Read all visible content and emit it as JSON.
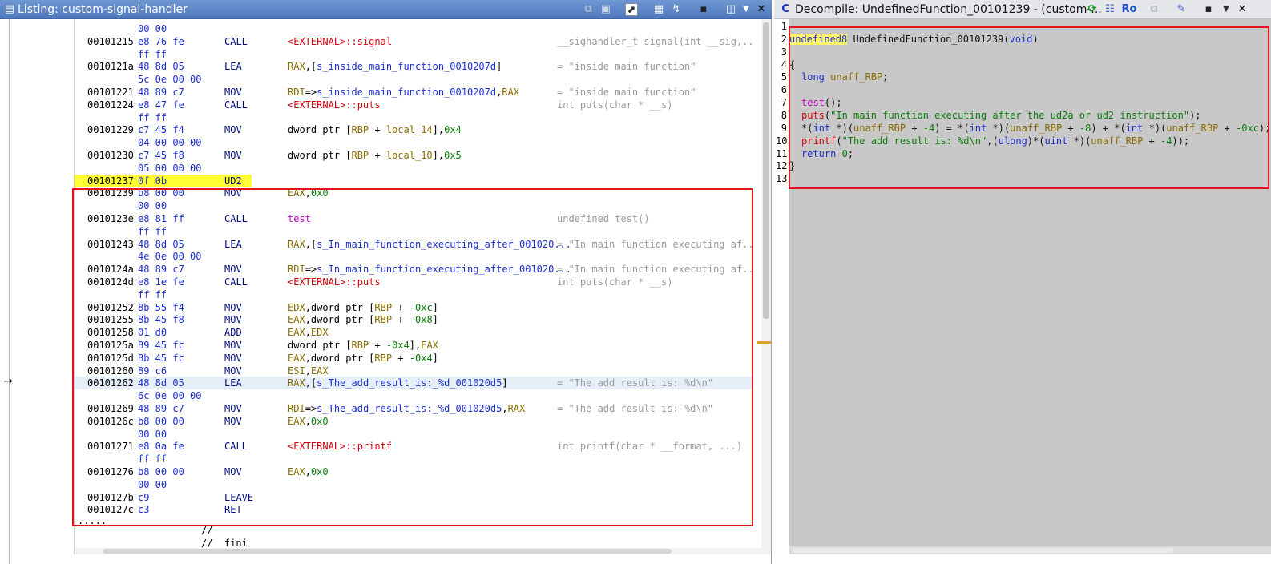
{
  "listing": {
    "title": "Listing:  custom-signal-handler",
    "rows": [
      {
        "addr": "",
        "bytes": "00 00",
        "mn": "",
        "ops": [],
        "cmt": ""
      },
      {
        "addr": "00101215",
        "bytes": "e8 76 fe",
        "mn": "CALL",
        "ops": [
          {
            "t": "<EXTERNAL>::signal",
            "c": "ext"
          }
        ],
        "cmt": "__sighandler_t signal(int __sig,..."
      },
      {
        "addr": "",
        "bytes": "ff ff",
        "mn": "",
        "ops": [],
        "cmt": ""
      },
      {
        "addr": "0010121a",
        "bytes": "48 8d 05",
        "mn": "LEA",
        "ops": [
          {
            "t": "RAX",
            "c": "reg"
          },
          {
            "t": ",[",
            "c": "blk"
          },
          {
            "t": "s_inside_main_function_0010207d",
            "c": "lbl"
          },
          {
            "t": "]",
            "c": "blk"
          }
        ],
        "cmt": "= \"inside main function\""
      },
      {
        "addr": "",
        "bytes": "5c 0e 00 00",
        "mn": "",
        "ops": [],
        "cmt": ""
      },
      {
        "addr": "00101221",
        "bytes": "48 89 c7",
        "mn": "MOV",
        "ops": [
          {
            "t": "RDI",
            "c": "reg"
          },
          {
            "t": "=>",
            "c": "blk"
          },
          {
            "t": "s_inside_main_function_0010207d",
            "c": "lbl"
          },
          {
            "t": ",",
            "c": "blk"
          },
          {
            "t": "RAX",
            "c": "reg"
          }
        ],
        "cmt": "= \"inside main function\""
      },
      {
        "addr": "00101224",
        "bytes": "e8 47 fe",
        "mn": "CALL",
        "ops": [
          {
            "t": "<EXTERNAL>::puts",
            "c": "ext"
          }
        ],
        "cmt": "int puts(char * __s)"
      },
      {
        "addr": "",
        "bytes": "ff ff",
        "mn": "",
        "ops": [],
        "cmt": ""
      },
      {
        "addr": "00101229",
        "bytes": "c7 45 f4",
        "mn": "MOV",
        "ops": [
          {
            "t": "dword ptr [",
            "c": "blk"
          },
          {
            "t": "RBP",
            "c": "reg"
          },
          {
            "t": " + ",
            "c": "blk"
          },
          {
            "t": "local_14",
            "c": "reg"
          },
          {
            "t": "],",
            "c": "blk"
          },
          {
            "t": "0x4",
            "c": "imm"
          }
        ],
        "cmt": ""
      },
      {
        "addr": "",
        "bytes": "04 00 00 00",
        "mn": "",
        "ops": [],
        "cmt": ""
      },
      {
        "addr": "00101230",
        "bytes": "c7 45 f8",
        "mn": "MOV",
        "ops": [
          {
            "t": "dword ptr [",
            "c": "blk"
          },
          {
            "t": "RBP",
            "c": "reg"
          },
          {
            "t": " + ",
            "c": "blk"
          },
          {
            "t": "local_10",
            "c": "reg"
          },
          {
            "t": "],",
            "c": "blk"
          },
          {
            "t": "0x5",
            "c": "imm"
          }
        ],
        "cmt": ""
      },
      {
        "addr": "",
        "bytes": "05 00 00 00",
        "mn": "",
        "ops": [],
        "cmt": ""
      },
      {
        "addr": "00101237",
        "bytes": "0f 0b",
        "mn": "UD2",
        "ops": [],
        "cmt": "",
        "hl": true
      },
      {
        "addr": "00101239",
        "bytes": "b8 00 00",
        "mn": "MOV",
        "ops": [
          {
            "t": "EAX",
            "c": "reg"
          },
          {
            "t": ",",
            "c": "blk"
          },
          {
            "t": "0x0",
            "c": "imm"
          }
        ],
        "cmt": ""
      },
      {
        "addr": "",
        "bytes": "00 00",
        "mn": "",
        "ops": [],
        "cmt": ""
      },
      {
        "addr": "0010123e",
        "bytes": "e8 81 ff",
        "mn": "CALL",
        "ops": [
          {
            "t": "test",
            "c": "fn"
          }
        ],
        "cmt": "undefined test()"
      },
      {
        "addr": "",
        "bytes": "ff ff",
        "mn": "",
        "ops": [],
        "cmt": ""
      },
      {
        "addr": "00101243",
        "bytes": "48 8d 05",
        "mn": "LEA",
        "ops": [
          {
            "t": "RAX",
            "c": "reg"
          },
          {
            "t": ",[",
            "c": "blk"
          },
          {
            "t": "s_In_main_function_executing_after_001020...",
            "c": "lbl"
          }
        ],
        "cmt": "= \"In main function executing af..."
      },
      {
        "addr": "",
        "bytes": "4e 0e 00 00",
        "mn": "",
        "ops": [],
        "cmt": ""
      },
      {
        "addr": "0010124a",
        "bytes": "48 89 c7",
        "mn": "MOV",
        "ops": [
          {
            "t": "RDI",
            "c": "reg"
          },
          {
            "t": "=>",
            "c": "blk"
          },
          {
            "t": "s_In_main_function_executing_after_001020...",
            "c": "lbl"
          }
        ],
        "cmt": "= \"In main function executing af..."
      },
      {
        "addr": "0010124d",
        "bytes": "e8 1e fe",
        "mn": "CALL",
        "ops": [
          {
            "t": "<EXTERNAL>::puts",
            "c": "ext"
          }
        ],
        "cmt": "int puts(char * __s)"
      },
      {
        "addr": "",
        "bytes": "ff ff",
        "mn": "",
        "ops": [],
        "cmt": ""
      },
      {
        "addr": "00101252",
        "bytes": "8b 55 f4",
        "mn": "MOV",
        "ops": [
          {
            "t": "EDX",
            "c": "reg"
          },
          {
            "t": ",dword ptr [",
            "c": "blk"
          },
          {
            "t": "RBP",
            "c": "reg"
          },
          {
            "t": " + ",
            "c": "blk"
          },
          {
            "t": "-0xc",
            "c": "imm"
          },
          {
            "t": "]",
            "c": "blk"
          }
        ],
        "cmt": ""
      },
      {
        "addr": "00101255",
        "bytes": "8b 45 f8",
        "mn": "MOV",
        "ops": [
          {
            "t": "EAX",
            "c": "reg"
          },
          {
            "t": ",dword ptr [",
            "c": "blk"
          },
          {
            "t": "RBP",
            "c": "reg"
          },
          {
            "t": " + ",
            "c": "blk"
          },
          {
            "t": "-0x8",
            "c": "imm"
          },
          {
            "t": "]",
            "c": "blk"
          }
        ],
        "cmt": ""
      },
      {
        "addr": "00101258",
        "bytes": "01 d0",
        "mn": "ADD",
        "ops": [
          {
            "t": "EAX",
            "c": "reg"
          },
          {
            "t": ",",
            "c": "blk"
          },
          {
            "t": "EDX",
            "c": "reg"
          }
        ],
        "cmt": ""
      },
      {
        "addr": "0010125a",
        "bytes": "89 45 fc",
        "mn": "MOV",
        "ops": [
          {
            "t": "dword ptr [",
            "c": "blk"
          },
          {
            "t": "RBP",
            "c": "reg"
          },
          {
            "t": " + ",
            "c": "blk"
          },
          {
            "t": "-0x4",
            "c": "imm"
          },
          {
            "t": "],",
            "c": "blk"
          },
          {
            "t": "EAX",
            "c": "reg"
          }
        ],
        "cmt": ""
      },
      {
        "addr": "0010125d",
        "bytes": "8b 45 fc",
        "mn": "MOV",
        "ops": [
          {
            "t": "EAX",
            "c": "reg"
          },
          {
            "t": ",dword ptr [",
            "c": "blk"
          },
          {
            "t": "RBP",
            "c": "reg"
          },
          {
            "t": " + ",
            "c": "blk"
          },
          {
            "t": "-0x4",
            "c": "imm"
          },
          {
            "t": "]",
            "c": "blk"
          }
        ],
        "cmt": ""
      },
      {
        "addr": "00101260",
        "bytes": "89 c6",
        "mn": "MOV",
        "ops": [
          {
            "t": "ESI",
            "c": "reg"
          },
          {
            "t": ",",
            "c": "blk"
          },
          {
            "t": "EAX",
            "c": "reg"
          }
        ],
        "cmt": ""
      },
      {
        "addr": "00101262",
        "bytes": "48 8d 05",
        "mn": "LEA",
        "ops": [
          {
            "t": "RAX",
            "c": "reg"
          },
          {
            "t": ",[",
            "c": "blk"
          },
          {
            "t": "s_The_add_result_is:_%d_001020d5",
            "c": "lbl"
          },
          {
            "t": "]",
            "c": "blk"
          }
        ],
        "cmt": "= \"The add result is: %d\\n\"",
        "cur": true
      },
      {
        "addr": "",
        "bytes": "6c 0e 00 00",
        "mn": "",
        "ops": [],
        "cmt": ""
      },
      {
        "addr": "00101269",
        "bytes": "48 89 c7",
        "mn": "MOV",
        "ops": [
          {
            "t": "RDI",
            "c": "reg"
          },
          {
            "t": "=>",
            "c": "blk"
          },
          {
            "t": "s_The_add_result_is:_%d_001020d5",
            "c": "lbl"
          },
          {
            "t": ",",
            "c": "blk"
          },
          {
            "t": "RAX",
            "c": "reg"
          }
        ],
        "cmt": "= \"The add result is: %d\\n\""
      },
      {
        "addr": "0010126c",
        "bytes": "b8 00 00",
        "mn": "MOV",
        "ops": [
          {
            "t": "EAX",
            "c": "reg"
          },
          {
            "t": ",",
            "c": "blk"
          },
          {
            "t": "0x0",
            "c": "imm"
          }
        ],
        "cmt": ""
      },
      {
        "addr": "",
        "bytes": "00 00",
        "mn": "",
        "ops": [],
        "cmt": ""
      },
      {
        "addr": "00101271",
        "bytes": "e8 0a fe",
        "mn": "CALL",
        "ops": [
          {
            "t": "<EXTERNAL>::printf",
            "c": "ext"
          }
        ],
        "cmt": "int printf(char * __format, ...)"
      },
      {
        "addr": "",
        "bytes": "ff ff",
        "mn": "",
        "ops": [],
        "cmt": ""
      },
      {
        "addr": "00101276",
        "bytes": "b8 00 00",
        "mn": "MOV",
        "ops": [
          {
            "t": "EAX",
            "c": "reg"
          },
          {
            "t": ",",
            "c": "blk"
          },
          {
            "t": "0x0",
            "c": "imm"
          }
        ],
        "cmt": ""
      },
      {
        "addr": "",
        "bytes": "00 00",
        "mn": "",
        "ops": [],
        "cmt": ""
      },
      {
        "addr": "0010127b",
        "bytes": "c9",
        "mn": "LEAVE",
        "ops": [],
        "cmt": ""
      },
      {
        "addr": "0010127c",
        "bytes": "c3",
        "mn": "RET",
        "ops": [],
        "cmt": ""
      }
    ],
    "trailer": [
      ".....",
      "//",
      "//  fini"
    ]
  },
  "decompile": {
    "title": "Decompile: UndefinedFunction_00101239 -  (custom-...",
    "ro_label": "Ro",
    "lines": [
      {
        "n": "1",
        "toks": []
      },
      {
        "n": "2",
        "toks": [
          {
            "t": "undefined8",
            "c": "ty hlty"
          },
          {
            "t": " UndefinedFunction_00101239(",
            "c": "ufn"
          },
          {
            "t": "void",
            "c": "kw"
          },
          {
            "t": ")",
            "c": "ufn"
          }
        ],
        "indent": 0
      },
      {
        "n": "3",
        "toks": []
      },
      {
        "n": "4",
        "toks": [
          {
            "t": "{",
            "c": "ufn"
          }
        ],
        "indent": 0
      },
      {
        "n": "5",
        "toks": [
          {
            "t": "long",
            "c": "kw"
          },
          {
            "t": " ",
            "c": "ufn"
          },
          {
            "t": "unaff_RBP",
            "c": "var"
          },
          {
            "t": ";",
            "c": "ufn"
          }
        ],
        "indent": 1
      },
      {
        "n": "6",
        "toks": []
      },
      {
        "n": "7",
        "toks": [
          {
            "t": "test",
            "c": "dfn"
          },
          {
            "t": "();",
            "c": "ufn"
          }
        ],
        "indent": 1
      },
      {
        "n": "8",
        "toks": [
          {
            "t": "puts",
            "c": "ext"
          },
          {
            "t": "(",
            "c": "ufn"
          },
          {
            "t": "\"In main function executing after the ud2a or ud2 instruction\"",
            "c": "str"
          },
          {
            "t": ");",
            "c": "ufn"
          }
        ],
        "indent": 1
      },
      {
        "n": "9",
        "toks": [
          {
            "t": "*(",
            "c": "ufn"
          },
          {
            "t": "int",
            "c": "kw"
          },
          {
            "t": " *)(",
            "c": "ufn"
          },
          {
            "t": "unaff_RBP",
            "c": "var"
          },
          {
            "t": " + ",
            "c": "ufn"
          },
          {
            "t": "-4",
            "c": "num"
          },
          {
            "t": ") = *(",
            "c": "ufn"
          },
          {
            "t": "int",
            "c": "kw"
          },
          {
            "t": " *)(",
            "c": "ufn"
          },
          {
            "t": "unaff_RBP",
            "c": "var"
          },
          {
            "t": " + ",
            "c": "ufn"
          },
          {
            "t": "-8",
            "c": "num"
          },
          {
            "t": ") + *(",
            "c": "ufn"
          },
          {
            "t": "int",
            "c": "kw"
          },
          {
            "t": " *)(",
            "c": "ufn"
          },
          {
            "t": "unaff_RBP",
            "c": "var"
          },
          {
            "t": " + ",
            "c": "ufn"
          },
          {
            "t": "-0xc",
            "c": "num"
          },
          {
            "t": ");",
            "c": "ufn"
          }
        ],
        "indent": 1
      },
      {
        "n": "10",
        "toks": [
          {
            "t": "printf",
            "c": "ext"
          },
          {
            "t": "(",
            "c": "ufn"
          },
          {
            "t": "\"The add result is: %d\\n\"",
            "c": "str"
          },
          {
            "t": ",(",
            "c": "ufn"
          },
          {
            "t": "ulong",
            "c": "kw"
          },
          {
            "t": ")*(",
            "c": "ufn"
          },
          {
            "t": "uint",
            "c": "kw"
          },
          {
            "t": " *)(",
            "c": "ufn"
          },
          {
            "t": "unaff_RBP",
            "c": "var"
          },
          {
            "t": " + ",
            "c": "ufn"
          },
          {
            "t": "-4",
            "c": "num"
          },
          {
            "t": "));",
            "c": "ufn"
          }
        ],
        "indent": 1
      },
      {
        "n": "11",
        "toks": [
          {
            "t": "return",
            "c": "kw"
          },
          {
            "t": " ",
            "c": "ufn"
          },
          {
            "t": "0",
            "c": "num"
          },
          {
            "t": ";",
            "c": "ufn"
          }
        ],
        "indent": 1
      },
      {
        "n": "12",
        "toks": [
          {
            "t": "}",
            "c": "ufn"
          }
        ],
        "indent": 0
      },
      {
        "n": "13",
        "toks": []
      }
    ]
  },
  "colors": {
    "highlight_line": "#ffff33",
    "annotation_box": "#e0141e",
    "decompile_bg": "#c8c8c8",
    "cursor_line": "#e6eef7"
  }
}
